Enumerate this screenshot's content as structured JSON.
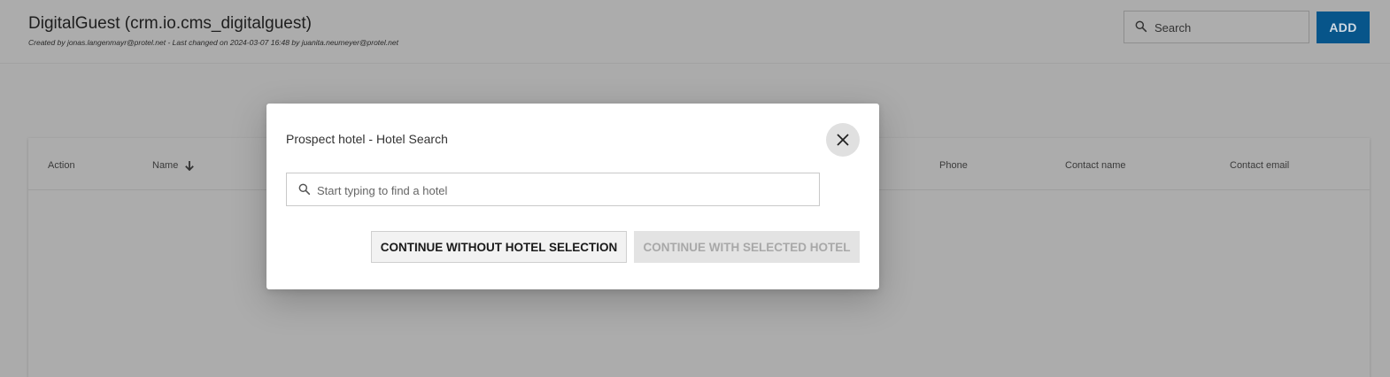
{
  "header": {
    "title": "DigitalGuest (crm.io.cms_digitalguest)",
    "meta": "Created by jonas.langenmayr@protel.net - Last changed on 2024-03-07 16:48 by juanita.neumeyer@protel.net",
    "search": {
      "placeholder": "Search",
      "icon": "search-icon"
    },
    "add_label": "ADD",
    "add_color": "#07558a"
  },
  "table": {
    "columns": {
      "action": "Action",
      "name": "Name",
      "phone": "Phone",
      "contact_name": "Contact name",
      "contact_email": "Contact email"
    },
    "sort_icon": "arrow-down-icon"
  },
  "modal": {
    "title": "Prospect hotel - Hotel Search",
    "close_icon": "close-icon",
    "search": {
      "placeholder": "Start typing to find a hotel",
      "icon": "search-icon"
    },
    "continue_without_label": "CONTINUE WITHOUT HOTEL SELECTION",
    "continue_with_label": "CONTINUE WITH SELECTED HOTEL"
  }
}
